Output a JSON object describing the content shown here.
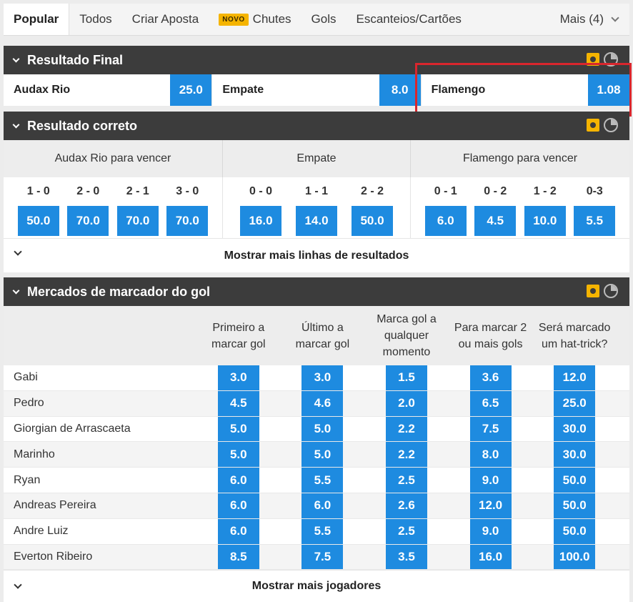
{
  "tabs": {
    "items": [
      {
        "label": "Popular"
      },
      {
        "label": "Todos"
      },
      {
        "label": "Criar Aposta"
      },
      {
        "label": "Chutes",
        "badge": "NOVO"
      },
      {
        "label": "Gols"
      },
      {
        "label": "Escanteios/Cartões"
      }
    ],
    "more_label": "Mais (4)"
  },
  "colors": {
    "accent": "#1e8be0",
    "header_bg": "#3c3c3c",
    "badge": "#f5b400",
    "highlight": "#d9262d"
  },
  "icons": [
    "chevron-down-icon",
    "live-stream-icon",
    "stats-icon"
  ],
  "resultado_final": {
    "title": "Resultado Final",
    "outcomes": [
      {
        "label": "Audax Rio",
        "odd": "25.0"
      },
      {
        "label": "Empate",
        "odd": "8.0"
      },
      {
        "label": "Flamengo",
        "odd": "1.08"
      }
    ]
  },
  "resultado_correto": {
    "title": "Resultado correto",
    "groups": [
      {
        "header": "Audax Rio para vencer",
        "scores": [
          {
            "score": "1 - 0",
            "odd": "50.0"
          },
          {
            "score": "2 - 0",
            "odd": "70.0"
          },
          {
            "score": "2 - 1",
            "odd": "70.0"
          },
          {
            "score": "3 - 0",
            "odd": "70.0"
          }
        ]
      },
      {
        "header": "Empate",
        "scores": [
          {
            "score": "0 - 0",
            "odd": "16.0"
          },
          {
            "score": "1 - 1",
            "odd": "14.0"
          },
          {
            "score": "2 - 2",
            "odd": "50.0"
          }
        ]
      },
      {
        "header": "Flamengo para vencer",
        "scores": [
          {
            "score": "0 - 1",
            "odd": "6.0"
          },
          {
            "score": "0 - 2",
            "odd": "4.5"
          },
          {
            "score": "1 - 2",
            "odd": "10.0"
          },
          {
            "score": "0-3",
            "odd": "5.5"
          }
        ]
      }
    ],
    "more_label": "Mostrar mais linhas de resultados"
  },
  "marcador": {
    "title": "Mercados de marcador do gol",
    "columns": [
      "Primeiro a marcar gol",
      "Último a marcar gol",
      "Marca gol a qualquer momento",
      "Para marcar 2 ou mais gols",
      "Será marcado um hat-trick?"
    ],
    "players": [
      {
        "name": "Gabi",
        "odds": [
          "3.0",
          "3.0",
          "1.5",
          "3.6",
          "12.0"
        ]
      },
      {
        "name": "Pedro",
        "odds": [
          "4.5",
          "4.6",
          "2.0",
          "6.5",
          "25.0"
        ]
      },
      {
        "name": "Giorgian de Arrascaeta",
        "odds": [
          "5.0",
          "5.0",
          "2.2",
          "7.5",
          "30.0"
        ]
      },
      {
        "name": "Marinho",
        "odds": [
          "5.0",
          "5.0",
          "2.2",
          "8.0",
          "30.0"
        ]
      },
      {
        "name": "Ryan",
        "odds": [
          "6.0",
          "5.5",
          "2.5",
          "9.0",
          "50.0"
        ]
      },
      {
        "name": "Andreas Pereira",
        "odds": [
          "6.0",
          "6.0",
          "2.6",
          "12.0",
          "50.0"
        ]
      },
      {
        "name": "Andre Luiz",
        "odds": [
          "6.0",
          "5.5",
          "2.5",
          "9.0",
          "50.0"
        ]
      },
      {
        "name": "Everton Ribeiro",
        "odds": [
          "8.5",
          "7.5",
          "3.5",
          "16.0",
          "100.0"
        ]
      }
    ],
    "more_label": "Mostrar mais jogadores"
  }
}
